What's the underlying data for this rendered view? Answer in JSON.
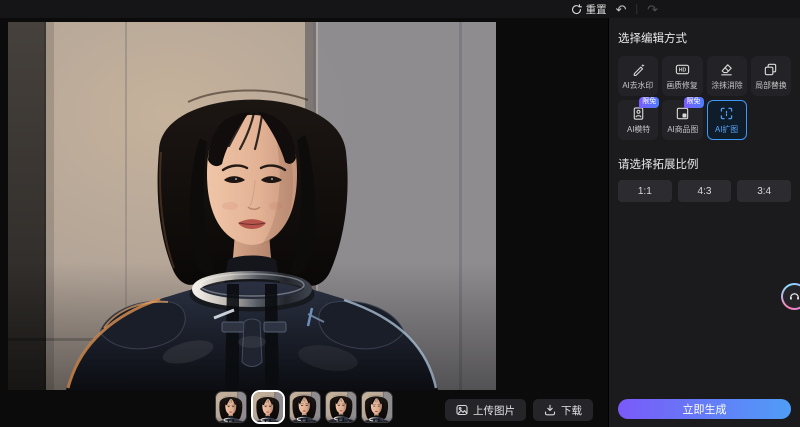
{
  "topbar": {
    "reset_label": "重置",
    "undo_icon": "↶",
    "redo_icon": "↷"
  },
  "panel": {
    "edit_method_title": "选择编辑方式",
    "tools": [
      {
        "label": "AI去水印",
        "icon": "watermark-remove-icon"
      },
      {
        "label": "画质修复",
        "icon": "hd-repair-icon"
      },
      {
        "label": "涂抹消除",
        "icon": "eraser-icon"
      },
      {
        "label": "局部替换",
        "icon": "replace-icon"
      },
      {
        "label": "AI模特",
        "icon": "model-icon",
        "badge": "限免"
      },
      {
        "label": "AI商品图",
        "icon": "product-image-icon",
        "badge": "限免"
      },
      {
        "label": "AI扩图",
        "icon": "expand-image-icon",
        "selected": true
      }
    ],
    "ratio_title": "请选择拓展比例",
    "ratios": [
      "1:1",
      "4:3",
      "3:4"
    ],
    "generate_label": "立即生成"
  },
  "bottom": {
    "upload_label": "上传图片",
    "download_label": "下载",
    "thumbnail_count": 5,
    "selected_thumbnail_index": 1
  },
  "colors": {
    "accent_blue": "#3f96f4",
    "badge_gradient": [
      "#7b5cff",
      "#4d7dff"
    ],
    "generate_gradient": [
      "#7a5af8",
      "#4f9df7"
    ]
  }
}
